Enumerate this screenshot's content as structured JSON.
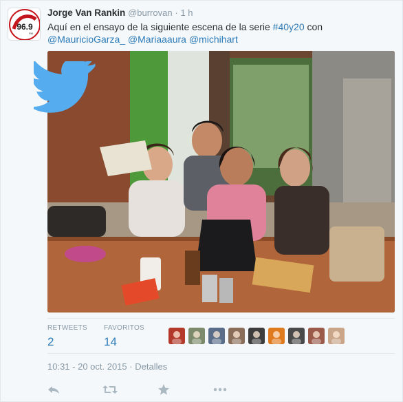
{
  "tweet": {
    "author": {
      "name": "Jorge Van Rankin",
      "handle": "@burrovan",
      "avatar_text": "96.9",
      "avatar_sub": "FM"
    },
    "separator": "·",
    "time_ago": "1 h",
    "text_before": "Aquí en el ensayo de la siguiente escena de la serie ",
    "hashtag": "#40y20",
    "text_after": " con",
    "mentions": [
      "@MauricioGarza_",
      "@Mariaaaura",
      "@michihart"
    ]
  },
  "stats": {
    "retweets_label": "RETWEETS",
    "retweets_value": "2",
    "favorites_label": "FAVORITOS",
    "favorites_value": "14"
  },
  "favoriters": [
    {
      "icon": "avatar-thumb-1",
      "color": "#b33a2a"
    },
    {
      "icon": "avatar-thumb-2",
      "color": "#7d8a6b"
    },
    {
      "icon": "avatar-thumb-3",
      "color": "#5a6e8a"
    },
    {
      "icon": "avatar-thumb-4",
      "color": "#8a6e5a"
    },
    {
      "icon": "avatar-thumb-5",
      "color": "#3d3d3d"
    },
    {
      "icon": "avatar-thumb-6",
      "color": "#e07a1f"
    },
    {
      "icon": "avatar-thumb-7",
      "color": "#4a4a4a"
    },
    {
      "icon": "avatar-thumb-8",
      "color": "#9c5a4a"
    },
    {
      "icon": "avatar-thumb-9",
      "color": "#c9a58a"
    }
  ],
  "timestamp": {
    "datetime": "10:31 - 20 oct. 2015",
    "separator": "·",
    "details_link": "Detalles"
  },
  "actions": [
    "reply-icon",
    "retweet-icon",
    "favorite-icon",
    "more-icon"
  ],
  "colors": {
    "link": "#2b7bb9",
    "twitter_bird": "#55acee",
    "muted": "#8899a6"
  }
}
